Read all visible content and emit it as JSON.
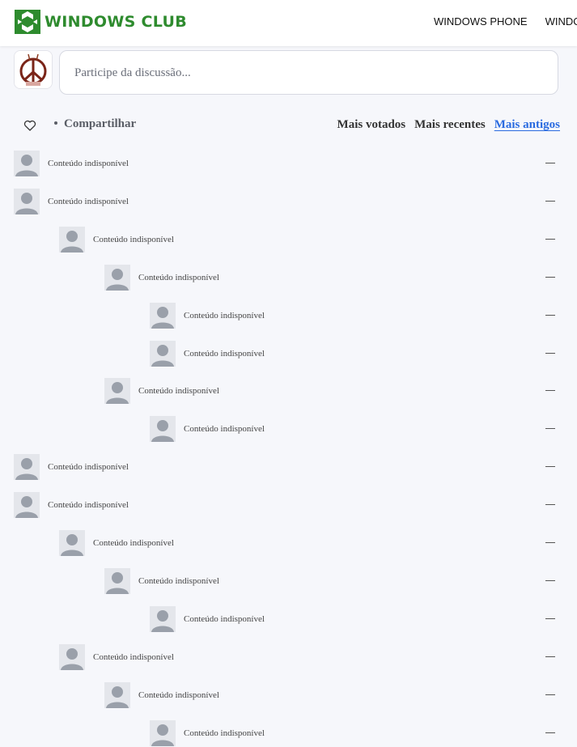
{
  "header": {
    "logo_text": "WINDOWS CLUB",
    "nav": [
      "WINDOWS PHONE",
      "WINDOW"
    ]
  },
  "composer": {
    "placeholder": "Participe da discussão..."
  },
  "toolbar": {
    "share_label": "Compartilhar",
    "sort_options": [
      "Mais votados",
      "Mais recentes",
      "Mais antigos"
    ],
    "active_sort": "Mais antigos"
  },
  "comments": [
    {
      "depth": 0,
      "text": "Conteúdo indisponível"
    },
    {
      "depth": 0,
      "text": "Conteúdo indisponível"
    },
    {
      "depth": 1,
      "text": "Conteúdo indisponível"
    },
    {
      "depth": 2,
      "text": "Conteúdo indisponível"
    },
    {
      "depth": 3,
      "text": "Conteúdo indisponível"
    },
    {
      "depth": 3,
      "text": "Conteúdo indisponível"
    },
    {
      "depth": 2,
      "text": "Conteúdo indisponível"
    },
    {
      "depth": 3,
      "text": "Conteúdo indisponível"
    },
    {
      "depth": 0,
      "text": "Conteúdo indisponível"
    },
    {
      "depth": 0,
      "text": "Conteúdo indisponível"
    },
    {
      "depth": 1,
      "text": "Conteúdo indisponível"
    },
    {
      "depth": 2,
      "text": "Conteúdo indisponível"
    },
    {
      "depth": 3,
      "text": "Conteúdo indisponível"
    },
    {
      "depth": 1,
      "text": "Conteúdo indisponível"
    },
    {
      "depth": 2,
      "text": "Conteúdo indisponível"
    },
    {
      "depth": 3,
      "text": "Conteúdo indisponível"
    }
  ],
  "colors": {
    "brand": "#2e8b2e",
    "active_link": "#2a6be0",
    "avatar_placeholder": "#9aa0aa"
  }
}
